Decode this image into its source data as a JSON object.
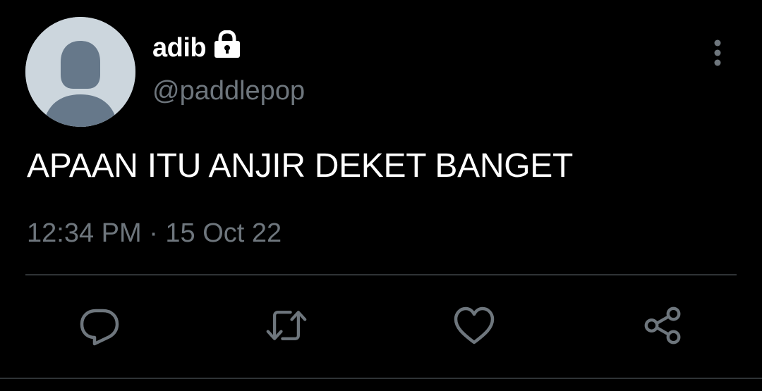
{
  "user": {
    "display_name": "adib",
    "handle": "@paddlepop",
    "protected": true,
    "avatar": "default-avatar-icon"
  },
  "tweet": {
    "text": "APAAN ITU ANJIR DEKET BANGET",
    "timestamp": "12:34 PM · 15 Oct 22"
  },
  "actions": {
    "reply": "reply-icon",
    "retweet": "retweet-icon",
    "like": "heart-icon",
    "share": "share-icon"
  },
  "colors": {
    "background": "#000000",
    "text": "#ffffff",
    "secondary_text": "#6e767d",
    "divider": "#2f3336",
    "avatar_bg": "#ccd6dd",
    "avatar_figure": "#66788a"
  }
}
